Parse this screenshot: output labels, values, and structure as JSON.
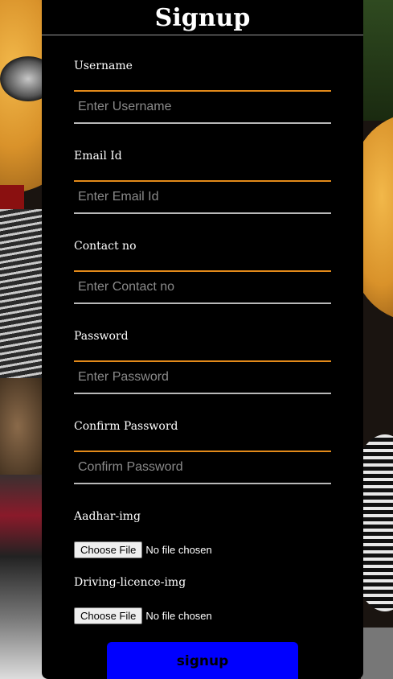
{
  "page": {
    "title": "Signup"
  },
  "fields": [
    {
      "label": "Username",
      "placeholder": "Enter Username",
      "value": ""
    },
    {
      "label": "Email Id",
      "placeholder": "Enter Email Id",
      "value": ""
    },
    {
      "label": "Contact no",
      "placeholder": "Enter Contact no",
      "value": ""
    },
    {
      "label": "Password",
      "placeholder": "Enter Password",
      "value": ""
    },
    {
      "label": "Confirm Password",
      "placeholder": "Confirm Password",
      "value": ""
    }
  ],
  "files": [
    {
      "label": "Aadhar-img",
      "button": "Choose File",
      "status": "No file chosen"
    },
    {
      "label": "Driving-licence-img",
      "button": "Choose File",
      "status": "No file chosen"
    }
  ],
  "submit": {
    "label": "signup",
    "color": "#0000ff"
  },
  "theme": {
    "panel_bg": "#000000",
    "accent_top_border": "#e38a1a",
    "bottom_border": "#b8b8b8"
  }
}
